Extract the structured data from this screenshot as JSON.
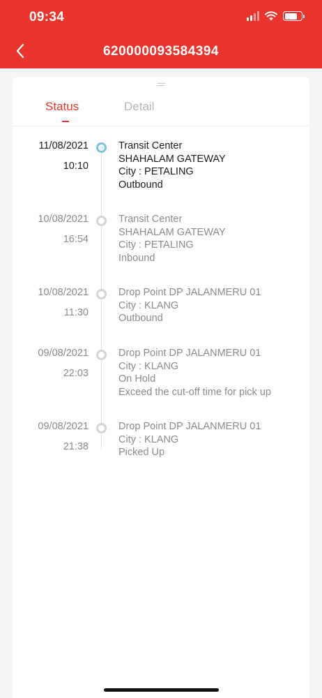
{
  "status_bar": {
    "time": "09:34"
  },
  "header": {
    "title": "620000093584394"
  },
  "tabs": [
    {
      "label": "Status"
    },
    {
      "label": "Detail"
    }
  ],
  "timeline": [
    {
      "date": "11/08/2021",
      "time": "10:10",
      "lines": [
        "Transit Center",
        "SHAHALAM GATEWAY",
        "City : PETALING",
        "Outbound"
      ]
    },
    {
      "date": "10/08/2021",
      "time": "16:54",
      "lines": [
        "Transit Center",
        "SHAHALAM GATEWAY",
        "City : PETALING",
        "Inbound"
      ]
    },
    {
      "date": "10/08/2021",
      "time": "11:30",
      "lines": [
        "Drop Point DP JALANMERU 01",
        "City : KLANG",
        "Outbound"
      ]
    },
    {
      "date": "09/08/2021",
      "time": "22:03",
      "lines": [
        "Drop Point DP JALANMERU 01",
        "City : KLANG",
        "On Hold",
        "Exceed the cut-off time for pick up"
      ]
    },
    {
      "date": "09/08/2021",
      "time": "21:38",
      "lines": [
        "Drop Point DP JALANMERU 01",
        "City : KLANG",
        "Picked Up"
      ]
    }
  ],
  "colors": {
    "brand_red": "#e8342d",
    "active_dot": "#7ec2de",
    "inactive_text": "#8a8a8a"
  }
}
